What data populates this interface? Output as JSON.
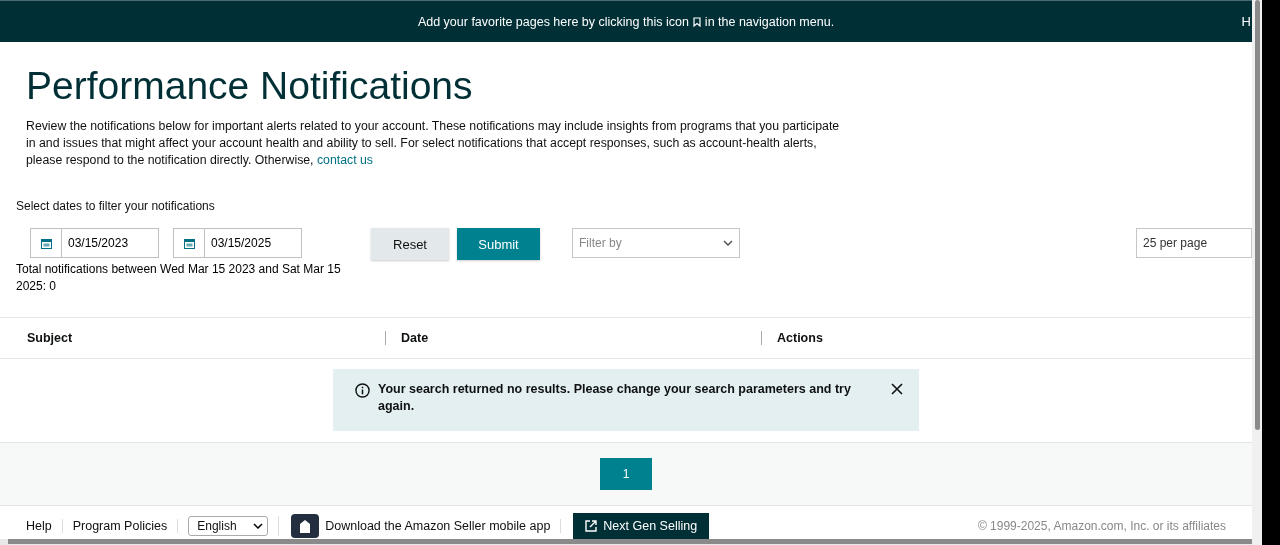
{
  "banner": {
    "text_before": "Add your favorite pages here by clicking this icon",
    "text_after": "in the navigation menu.",
    "edge_text": "H"
  },
  "page": {
    "title": "Performance Notifications",
    "description": "Review the notifications below for important alerts related to your account. These notifications may include insights from programs that you participate in and issues that might affect your account health and ability to sell. For select notifications that accept responses, such as account-health alerts, please respond to the notification directly. Otherwise,",
    "link": "contact us"
  },
  "filters": {
    "label": "Select dates to filter your notifications",
    "start_date": "03/15/2023",
    "end_date": "03/15/2025",
    "total": "Total notifications between Wed Mar 15 2023 and Sat Mar 15 2025: 0",
    "buttons": [
      {
        "label": "Reset",
        "kind": "secondary"
      },
      {
        "label": "Submit",
        "kind": "primary"
      }
    ],
    "filter_placeholder": "Filter by",
    "per_page": "25 per page"
  },
  "table": {
    "columns": [
      "Subject",
      "Date",
      "Actions"
    ]
  },
  "alert": {
    "text": "Your search returned no results. Please change your search parameters and try again."
  },
  "pagination": [
    {
      "label": "1",
      "selected": true
    }
  ],
  "footer": {
    "links": [
      "Help",
      "Program Policies"
    ],
    "language": "English",
    "app_text": "Download the Amazon Seller mobile app",
    "next_gen": "Next Gen Selling",
    "copyright": "© 1999-2025, Amazon.com, Inc. or its affiliates"
  }
}
